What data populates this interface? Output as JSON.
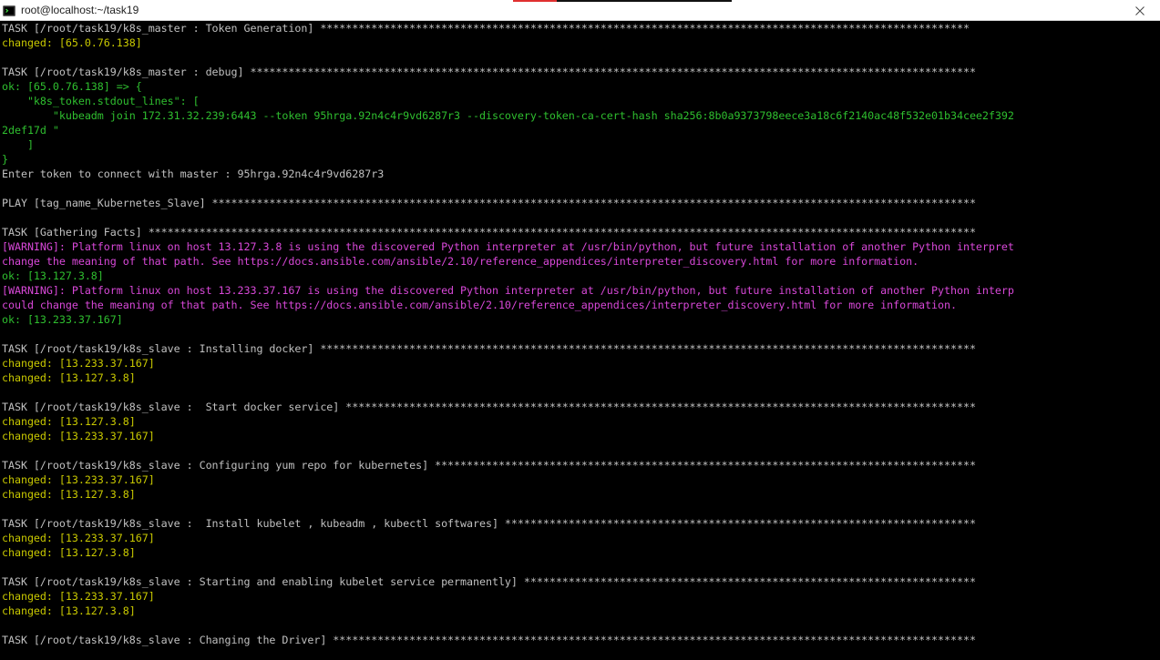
{
  "window": {
    "title": "root@localhost:~/task19",
    "icon": "terminal-icon",
    "close_icon": "close-icon"
  },
  "colors": {
    "white": "#c0c0c0",
    "changed": "#c8c800",
    "ok": "#2fbf2f",
    "warning": "#d848d8",
    "background": "#000000"
  },
  "lines": [
    {
      "c": "w",
      "t": "TASK [/root/task19/k8s_master : Token Generation] ******************************************************************************************************"
    },
    {
      "c": "y",
      "t": "changed: [65.0.76.138]"
    },
    {
      "c": "w",
      "t": ""
    },
    {
      "c": "w",
      "t": "TASK [/root/task19/k8s_master : debug] ******************************************************************************************************************"
    },
    {
      "c": "g",
      "t": "ok: [65.0.76.138] => {"
    },
    {
      "c": "g",
      "t": "    \"k8s_token.stdout_lines\": ["
    },
    {
      "c": "g",
      "t": "        \"kubeadm join 172.31.32.239:6443 --token 95hrga.92n4c4r9vd6287r3 --discovery-token-ca-cert-hash sha256:8b0a9373798eece3a18c6f2140ac48f532e01b34cee2f392"
    },
    {
      "c": "g",
      "t": "2def17d \""
    },
    {
      "c": "g",
      "t": "    ]"
    },
    {
      "c": "g",
      "t": "}"
    },
    {
      "c": "w",
      "t": "Enter token to connect with master : 95hrga.92n4c4r9vd6287r3"
    },
    {
      "c": "w",
      "t": ""
    },
    {
      "c": "w",
      "t": "PLAY [tag_name_Kubernetes_Slave] ************************************************************************************************************************"
    },
    {
      "c": "w",
      "t": ""
    },
    {
      "c": "w",
      "t": "TASK [Gathering Facts] **********************************************************************************************************************************"
    },
    {
      "c": "m",
      "t": "[WARNING]: Platform linux on host 13.127.3.8 is using the discovered Python interpreter at /usr/bin/python, but future installation of another Python interpret"
    },
    {
      "c": "m",
      "t": "change the meaning of that path. See https://docs.ansible.com/ansible/2.10/reference_appendices/interpreter_discovery.html for more information."
    },
    {
      "c": "g",
      "t": "ok: [13.127.3.8]"
    },
    {
      "c": "m",
      "t": "[WARNING]: Platform linux on host 13.233.37.167 is using the discovered Python interpreter at /usr/bin/python, but future installation of another Python interp"
    },
    {
      "c": "m",
      "t": "could change the meaning of that path. See https://docs.ansible.com/ansible/2.10/reference_appendices/interpreter_discovery.html for more information."
    },
    {
      "c": "g",
      "t": "ok: [13.233.37.167]"
    },
    {
      "c": "w",
      "t": ""
    },
    {
      "c": "w",
      "t": "TASK [/root/task19/k8s_slave : Installing docker] *******************************************************************************************************"
    },
    {
      "c": "y",
      "t": "changed: [13.233.37.167]"
    },
    {
      "c": "y",
      "t": "changed: [13.127.3.8]"
    },
    {
      "c": "w",
      "t": ""
    },
    {
      "c": "w",
      "t": "TASK [/root/task19/k8s_slave :  Start docker service] ***************************************************************************************************"
    },
    {
      "c": "y",
      "t": "changed: [13.127.3.8]"
    },
    {
      "c": "y",
      "t": "changed: [13.233.37.167]"
    },
    {
      "c": "w",
      "t": ""
    },
    {
      "c": "w",
      "t": "TASK [/root/task19/k8s_slave : Configuring yum repo for kubernetes] *************************************************************************************"
    },
    {
      "c": "y",
      "t": "changed: [13.233.37.167]"
    },
    {
      "c": "y",
      "t": "changed: [13.127.3.8]"
    },
    {
      "c": "w",
      "t": ""
    },
    {
      "c": "w",
      "t": "TASK [/root/task19/k8s_slave :  Install kubelet , kubeadm , kubectl softwares] **************************************************************************"
    },
    {
      "c": "y",
      "t": "changed: [13.233.37.167]"
    },
    {
      "c": "y",
      "t": "changed: [13.127.3.8]"
    },
    {
      "c": "w",
      "t": ""
    },
    {
      "c": "w",
      "t": "TASK [/root/task19/k8s_slave : Starting and enabling kubelet service permanently] ***********************************************************************"
    },
    {
      "c": "y",
      "t": "changed: [13.233.37.167]"
    },
    {
      "c": "y",
      "t": "changed: [13.127.3.8]"
    },
    {
      "c": "w",
      "t": ""
    },
    {
      "c": "w",
      "t": "TASK [/root/task19/k8s_slave : Changing the Driver] *****************************************************************************************************"
    }
  ]
}
